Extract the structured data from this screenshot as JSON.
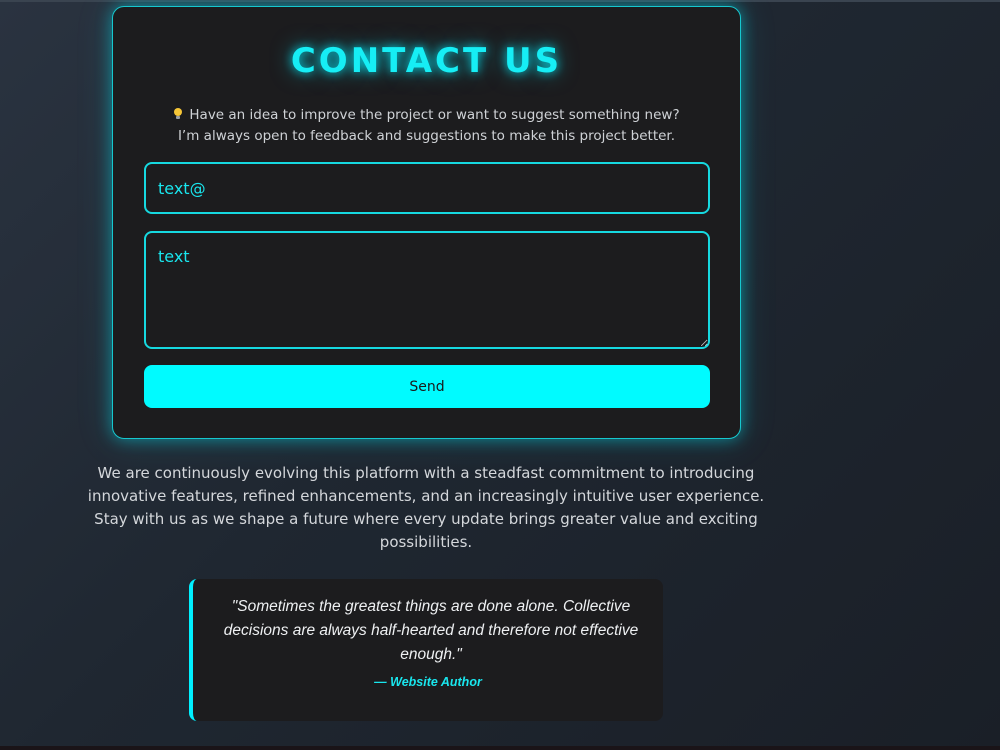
{
  "contact": {
    "title": "CONTACT US",
    "subtitle_line1": "Have an idea to improve the project or want to suggest something new?",
    "subtitle_line2": "I’m always open to feedback and suggestions to make this project better.",
    "email_value": "text@",
    "message_value": "text",
    "send_label": "Send",
    "icon": "lightbulb-icon"
  },
  "info": {
    "paragraph": "We are continuously evolving this platform with a steadfast commitment to introducing innovative features, refined enhancements, and an increasingly intuitive user experience. Stay with us as we shape a future where every update brings greater value and exciting possibilities."
  },
  "quote": {
    "text": "\"Sometimes the greatest things are done alone. Collective decisions are always half-hearted and therefore not effective enough.\"",
    "author": "— Website Author"
  },
  "colors": {
    "accent": "#00fbff",
    "card_bg": "#1c1c1e",
    "page_bg": "#222a34"
  }
}
